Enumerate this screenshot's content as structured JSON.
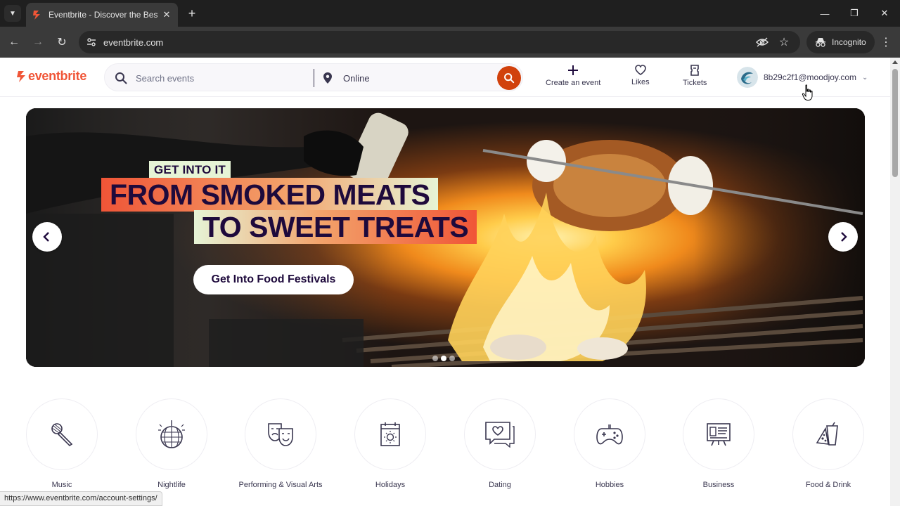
{
  "browser": {
    "tab_title": "Eventbrite - Discover the Best Local Events & Things to Do",
    "url": "eventbrite.com",
    "incognito_label": "Incognito",
    "status_url": "https://www.eventbrite.com/account-settings/"
  },
  "header": {
    "logo_text": "eventbrite",
    "search_placeholder": "Search events",
    "location_value": "Online",
    "nav": {
      "create_label": "Create an event",
      "likes_label": "Likes",
      "tickets_label": "Tickets"
    },
    "account_email": "8b29c2f1@moodjoy.com"
  },
  "hero": {
    "eyebrow": "GET INTO IT",
    "line1": "FROM SMOKED MEATS",
    "line2": "TO SWEET TREATS",
    "cta": "Get Into Food Festivals",
    "slide_count": 3,
    "active_slide": 2
  },
  "categories": [
    {
      "label": "Music",
      "icon": "microphone-icon"
    },
    {
      "label": "Nightlife",
      "icon": "disco-ball-icon"
    },
    {
      "label": "Performing & Visual Arts",
      "icon": "theater-masks-icon"
    },
    {
      "label": "Holidays",
      "icon": "calendar-sun-icon"
    },
    {
      "label": "Dating",
      "icon": "heart-chat-icon"
    },
    {
      "label": "Hobbies",
      "icon": "gamepad-icon"
    },
    {
      "label": "Business",
      "icon": "presentation-board-icon"
    },
    {
      "label": "Food & Drink",
      "icon": "food-drink-icon"
    }
  ],
  "colors": {
    "brand": "#f05537",
    "search_button": "#d1410c",
    "text_dark": "#1e0a3c",
    "text": "#39364f"
  }
}
